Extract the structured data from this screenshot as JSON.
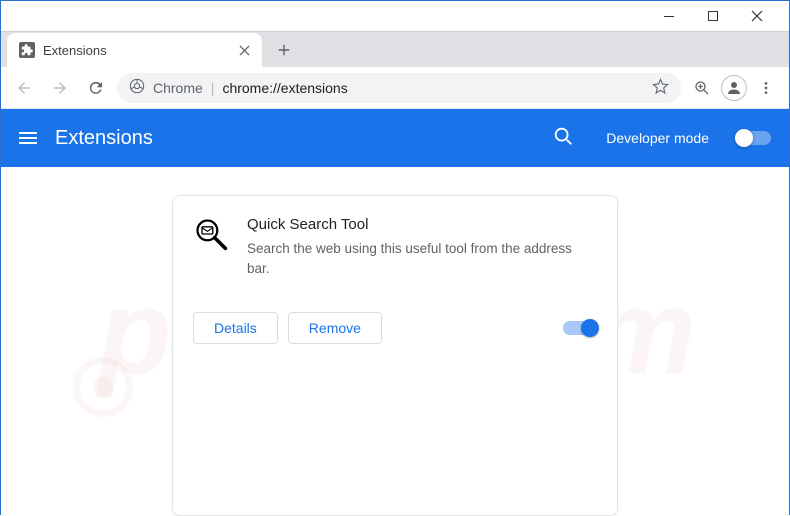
{
  "window": {
    "tab": {
      "title": "Extensions"
    }
  },
  "omnibox": {
    "prefix": "Chrome",
    "url": "chrome://extensions"
  },
  "header": {
    "title": "Extensions",
    "dev_mode_label": "Developer mode"
  },
  "card": {
    "title": "Quick Search Tool",
    "description": "Search the web using this useful tool from the address bar.",
    "details_label": "Details",
    "remove_label": "Remove",
    "enabled": true
  },
  "watermark": {
    "text": "pcrisk.com"
  }
}
